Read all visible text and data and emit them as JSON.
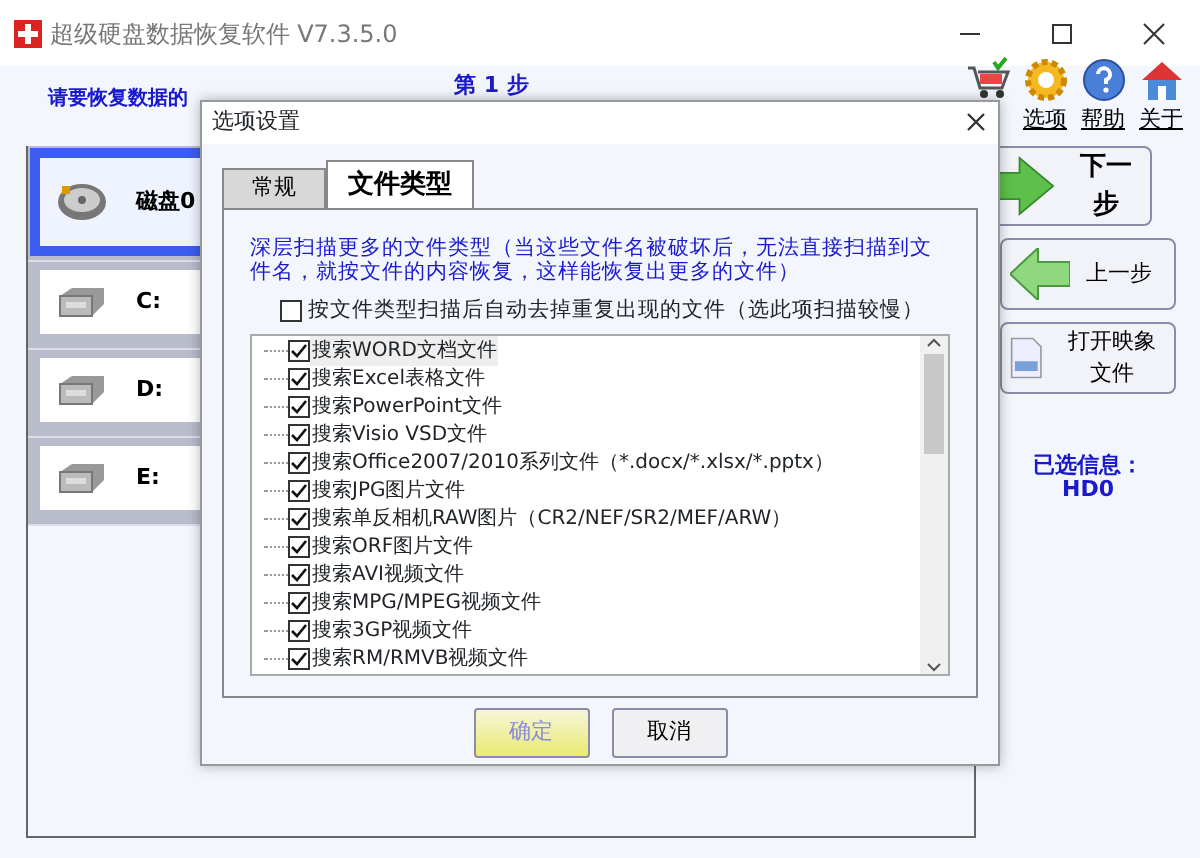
{
  "window": {
    "title": "超级硬盘数据恢复软件 V7.3.5.0"
  },
  "header": {
    "step": "第 1 步",
    "instruction": "请要恢复数据的"
  },
  "toolbar": [
    {
      "kind": "cart"
    },
    {
      "kind": "gear",
      "label": "选项"
    },
    {
      "kind": "help",
      "label": "帮助"
    },
    {
      "kind": "home",
      "label": "关于"
    }
  ],
  "drives": [
    {
      "kind": "disk",
      "label": "磁盘0",
      "selected": true
    },
    {
      "kind": "partition",
      "label": "C:",
      "selected": false
    },
    {
      "kind": "partition",
      "label": "D:",
      "selected": false
    },
    {
      "kind": "partition",
      "label": "E:",
      "selected": false
    }
  ],
  "actions": [
    {
      "kind": "next",
      "label": "下一步"
    },
    {
      "kind": "prev",
      "label": "上一步"
    },
    {
      "kind": "image",
      "label": "打开映象文件"
    }
  ],
  "selected_info": {
    "label": "已选信息：",
    "value": "HD0"
  },
  "dialog": {
    "title": "选项设置",
    "tabs": [
      {
        "label": "常规",
        "selected": false
      },
      {
        "label": "文件类型",
        "selected": true
      }
    ],
    "description": "深层扫描更多的文件类型（当这些文件名被破坏后，无法直接扫描到文件名，就按文件的内容恢复，这样能恢复出更多的文件）",
    "dedupe": {
      "label": "按文件类型扫描后自动去掉重复出现的文件（选此项扫描较慢）",
      "checked": false
    },
    "file_types": [
      {
        "label": "搜索WORD文档文件",
        "checked": true,
        "selected": true
      },
      {
        "label": "搜索Excel表格文件",
        "checked": true,
        "selected": false
      },
      {
        "label": "搜索PowerPoint文件",
        "checked": true,
        "selected": false
      },
      {
        "label": "搜索Visio VSD文件",
        "checked": true,
        "selected": false
      },
      {
        "label": "搜索Office2007/2010系列文件（*.docx/*.xlsx/*.pptx）",
        "checked": true,
        "selected": false
      },
      {
        "label": "搜索JPG图片文件",
        "checked": true,
        "selected": false
      },
      {
        "label": "搜索单反相机RAW图片（CR2/NEF/SR2/MEF/ARW）",
        "checked": true,
        "selected": false
      },
      {
        "label": "搜索ORF图片文件",
        "checked": true,
        "selected": false
      },
      {
        "label": "搜索AVI视频文件",
        "checked": true,
        "selected": false
      },
      {
        "label": "搜索MPG/MPEG视频文件",
        "checked": true,
        "selected": false
      },
      {
        "label": "搜索3GP视频文件",
        "checked": true,
        "selected": false
      },
      {
        "label": "搜索RM/RMVB视频文件",
        "checked": true,
        "selected": false
      }
    ],
    "buttons": [
      {
        "kind": "default",
        "label": "确定"
      },
      {
        "kind": "normal",
        "label": "取消"
      }
    ]
  }
}
